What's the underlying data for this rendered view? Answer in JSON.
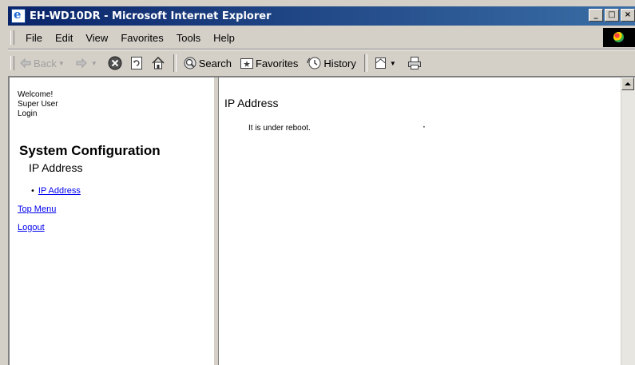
{
  "window": {
    "title": "EH-WD10DR - Microsoft Internet Explorer",
    "min_label": "_",
    "max_label": "□",
    "close_label": "×"
  },
  "menubar": {
    "items": [
      "File",
      "Edit",
      "View",
      "Favorites",
      "Tools",
      "Help"
    ]
  },
  "toolbar": {
    "back_label": "Back",
    "search_label": "Search",
    "favorites_label": "Favorites",
    "history_label": "History"
  },
  "left_frame": {
    "welcome": "Welcome!",
    "user": "Super User",
    "login": "Login",
    "section_title": "System Configuration",
    "subsection": "IP Address",
    "nav_link": "IP Address",
    "top_menu": "Top Menu",
    "logout": "Logout"
  },
  "right_frame": {
    "heading": "IP Address",
    "status": "It is under reboot."
  },
  "colors": {
    "titlebar_start": "#0a246a",
    "titlebar_end": "#3a6ea5",
    "link": "#0000ee",
    "chrome": "#d4d0c8"
  }
}
